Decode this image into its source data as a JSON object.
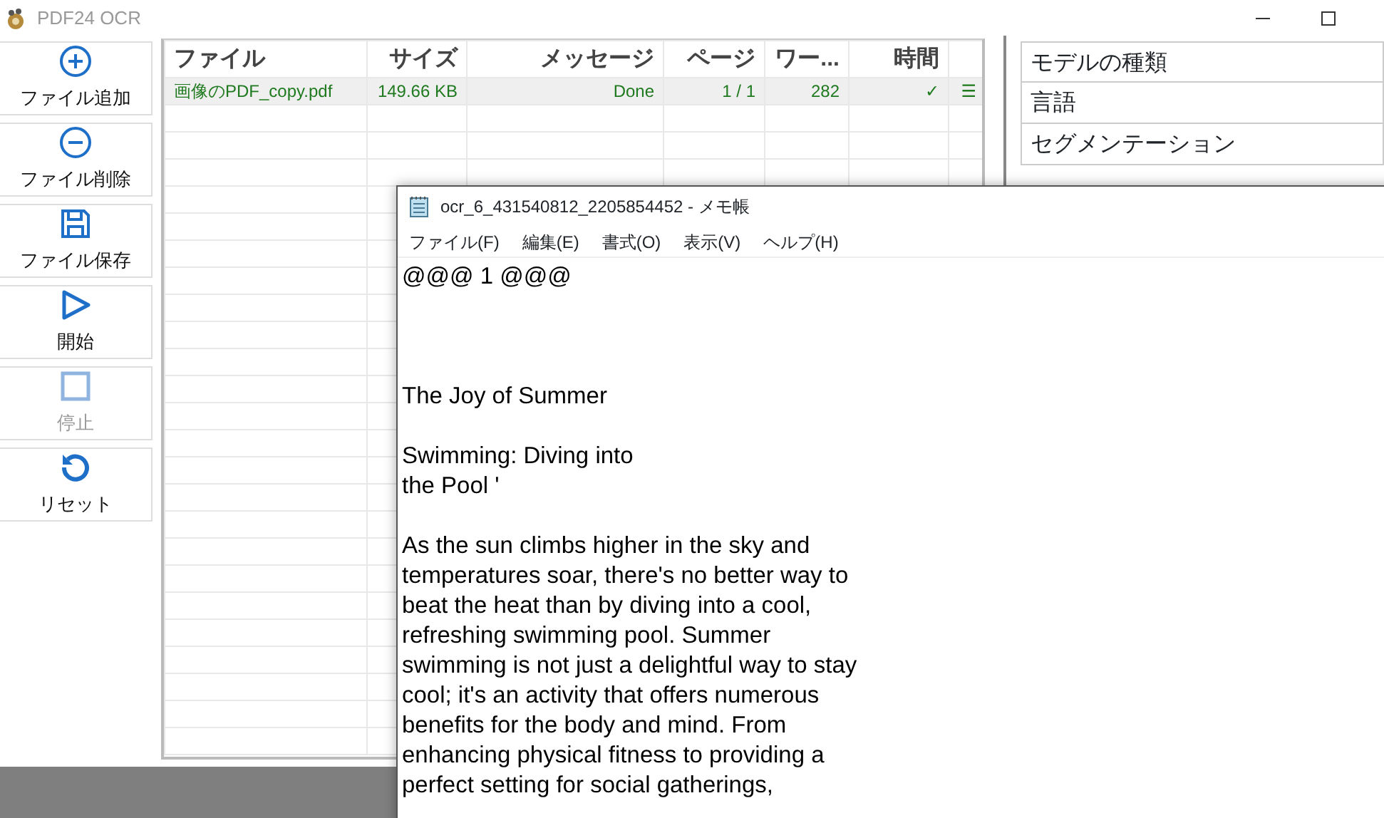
{
  "app": {
    "title": "PDF24 OCR"
  },
  "toolbar": [
    {
      "kind": "add",
      "label": "ファイル追加",
      "disabled": false
    },
    {
      "kind": "remove",
      "label": "ファイル削除",
      "disabled": false
    },
    {
      "kind": "save",
      "label": "ファイル保存",
      "disabled": false
    },
    {
      "kind": "start",
      "label": "開始",
      "disabled": false
    },
    {
      "kind": "stop",
      "label": "停止",
      "disabled": true
    },
    {
      "kind": "reset",
      "label": "リセット",
      "disabled": false
    }
  ],
  "table": {
    "columns": [
      "ファイル",
      "サイズ",
      "メッセージ",
      "ページ",
      "ワー...",
      "時間"
    ],
    "rows": [
      {
        "cells": [
          "画像のPDF_copy.pdf",
          "149.66 KB",
          "Done",
          "1 / 1",
          "282",
          "✓",
          "☰"
        ]
      }
    ]
  },
  "settings_panel": {
    "items": [
      "モデルの種類",
      "言語",
      "セグメンテーション"
    ]
  },
  "notepad": {
    "title": "ocr_6_431540812_2205854452 - メモ帳",
    "menu": [
      "ファイル(F)",
      "編集(E)",
      "書式(O)",
      "表示(V)",
      "ヘルプ(H)"
    ],
    "blocks": [
      {
        "lines": [
          "@@@ 1 @@@"
        ]
      },
      {
        "lines": [
          "The Joy of Summer"
        ]
      },
      {
        "lines": [
          "Swimming: Diving into",
          "the Pool '"
        ]
      },
      {
        "lines": [
          "As the sun climbs higher in the sky and",
          "temperatures soar, there's no better way to",
          "beat the heat than by diving into a cool,",
          "refreshing swimming pool. Summer",
          "swimming is not just a delightful way to stay",
          "cool; it's an activity that offers numerous",
          "benefits for the body and mind. From",
          "enhancing physical fitness to providing a",
          "perfect setting for social gatherings,"
        ]
      }
    ]
  }
}
